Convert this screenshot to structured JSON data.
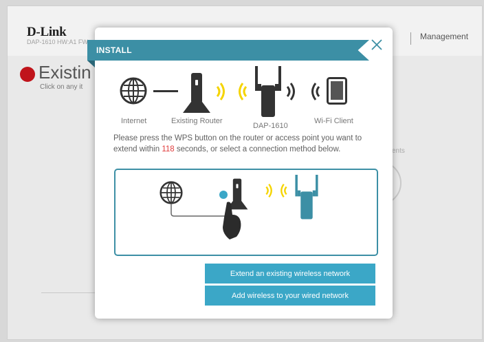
{
  "app": {
    "brand": "D-Link",
    "model_line": "DAP-1610   HW:A1   FW",
    "nav_management": "Management"
  },
  "background_page": {
    "title": "Existin",
    "subtitle": "Click on any it",
    "partial_label": "ents"
  },
  "modal": {
    "title": "INSTALL",
    "close_icon": "close-icon",
    "diagram": {
      "internet_label": "Internet",
      "router_label": "Existing Router",
      "extender_label": "DAP-1610",
      "client_label": "Wi-Fi Client"
    },
    "instructions_before": "Please press the WPS button on the router or access point you want to extend within ",
    "countdown": "118",
    "instructions_after": " seconds, or select a connection method below.",
    "buttons": {
      "extend": "Extend an existing wireless network",
      "add_wireless": "Add wireless to your wired network"
    }
  },
  "colors": {
    "accent": "#3c8fa5",
    "button": "#3ba7c7",
    "countdown": "#e03b3b",
    "wave": "#f5d400",
    "extender": "#3c8fa5"
  }
}
